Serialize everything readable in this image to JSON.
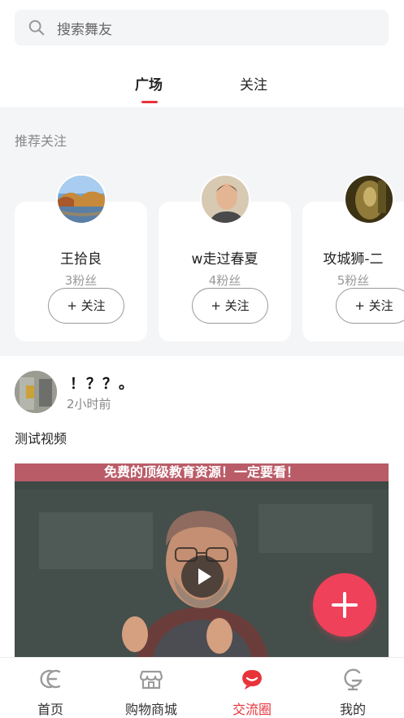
{
  "search": {
    "placeholder": "搜索舞友"
  },
  "tabs": [
    {
      "label": "广场",
      "active": true
    },
    {
      "label": "关注",
      "active": false
    }
  ],
  "recommend": {
    "title": "推荐关注",
    "cards": [
      {
        "name": "王拾良",
        "fans": "3粉丝",
        "follow_label": "+ 关注"
      },
      {
        "name": "w走过春夏",
        "fans": "4粉丝",
        "follow_label": "+ 关注"
      },
      {
        "name": "攻城狮-二",
        "fans": "5粉丝",
        "follow_label": "+ 关注"
      }
    ]
  },
  "post": {
    "author": "！？？。",
    "time": "2小时前",
    "text": "测试视频",
    "video_banner": "免费的顶级教育资源！一定要看！"
  },
  "bottom_nav": [
    {
      "label": "首页",
      "icon": "home-icon",
      "active": false
    },
    {
      "label": "购物商城",
      "icon": "shop-icon",
      "active": false
    },
    {
      "label": "交流圈",
      "icon": "community-icon",
      "active": true
    },
    {
      "label": "我的",
      "icon": "profile-icon",
      "active": false
    }
  ],
  "colors": {
    "accent": "#e8333a",
    "fab": "#f0415a",
    "background": "#f4f5f7"
  }
}
